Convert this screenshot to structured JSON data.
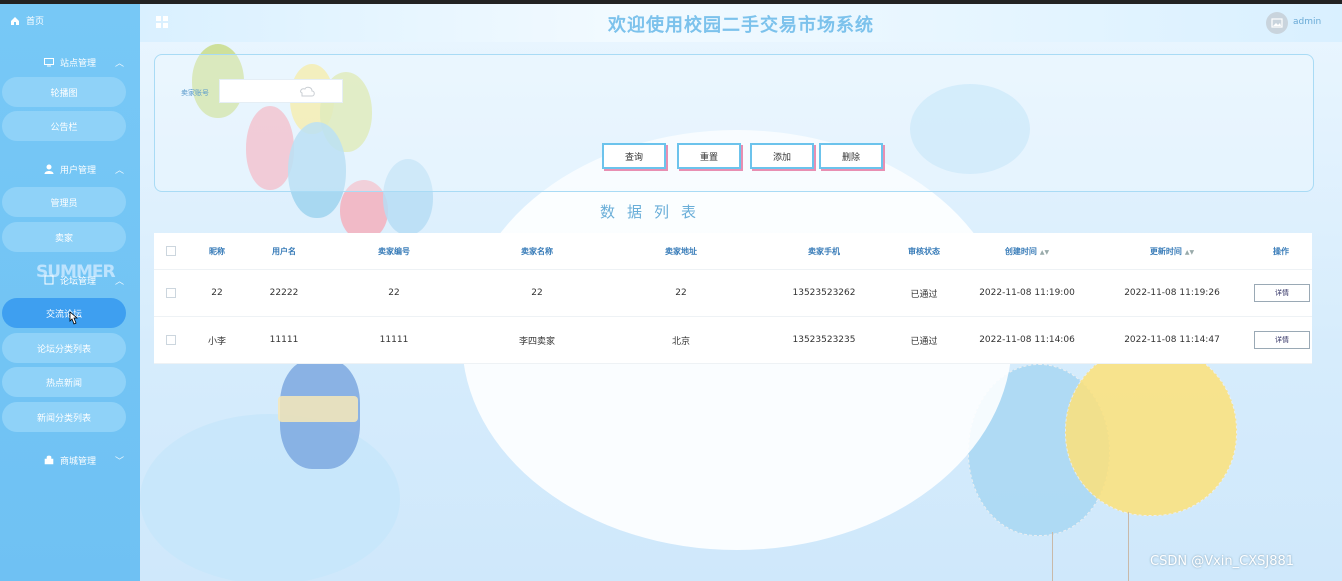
{
  "sidebar": {
    "home": "首页",
    "groups": [
      {
        "label": "站点管理",
        "items": [
          "轮播图",
          "公告栏"
        ]
      },
      {
        "label": "用户管理",
        "items": [
          "管理员",
          "卖家"
        ]
      },
      {
        "label": "论坛管理",
        "items": [
          "交流论坛",
          "论坛分类列表",
          "热点新闻",
          "新闻分类列表"
        ]
      },
      {
        "label": "商城管理",
        "items": []
      }
    ],
    "decor_text": "SUMMER"
  },
  "header": {
    "title": "欢迎使用校园二手交易市场系统",
    "user": "admin"
  },
  "search": {
    "label": "卖家账号",
    "value": "",
    "buttons": [
      "查询",
      "重置",
      "添加",
      "删除"
    ]
  },
  "list": {
    "title": "数据列表",
    "columns": [
      "昵称",
      "用户名",
      "卖家编号",
      "卖家名称",
      "卖家地址",
      "卖家手机",
      "审核状态",
      "创建时间",
      "更新时间",
      "操作"
    ],
    "rows": [
      [
        "22",
        "22222",
        "22",
        "22",
        "22",
        "13523523262",
        "已通过",
        "2022-11-08 11:19:00",
        "2022-11-08 11:19:26",
        "详情"
      ],
      [
        "小李",
        "11111",
        "11111",
        "李四卖家",
        "北京",
        "13523523235",
        "已通过",
        "2022-11-08 11:14:06",
        "2022-11-08 11:14:47",
        "详情"
      ]
    ]
  },
  "watermark": "CSDN @Vxin_CXSJ881",
  "colors": {
    "sidebar": "#77c8f6",
    "active_item": "#3e9ff0",
    "title": "#7cc2ec",
    "header_text": "#3a7db9"
  }
}
